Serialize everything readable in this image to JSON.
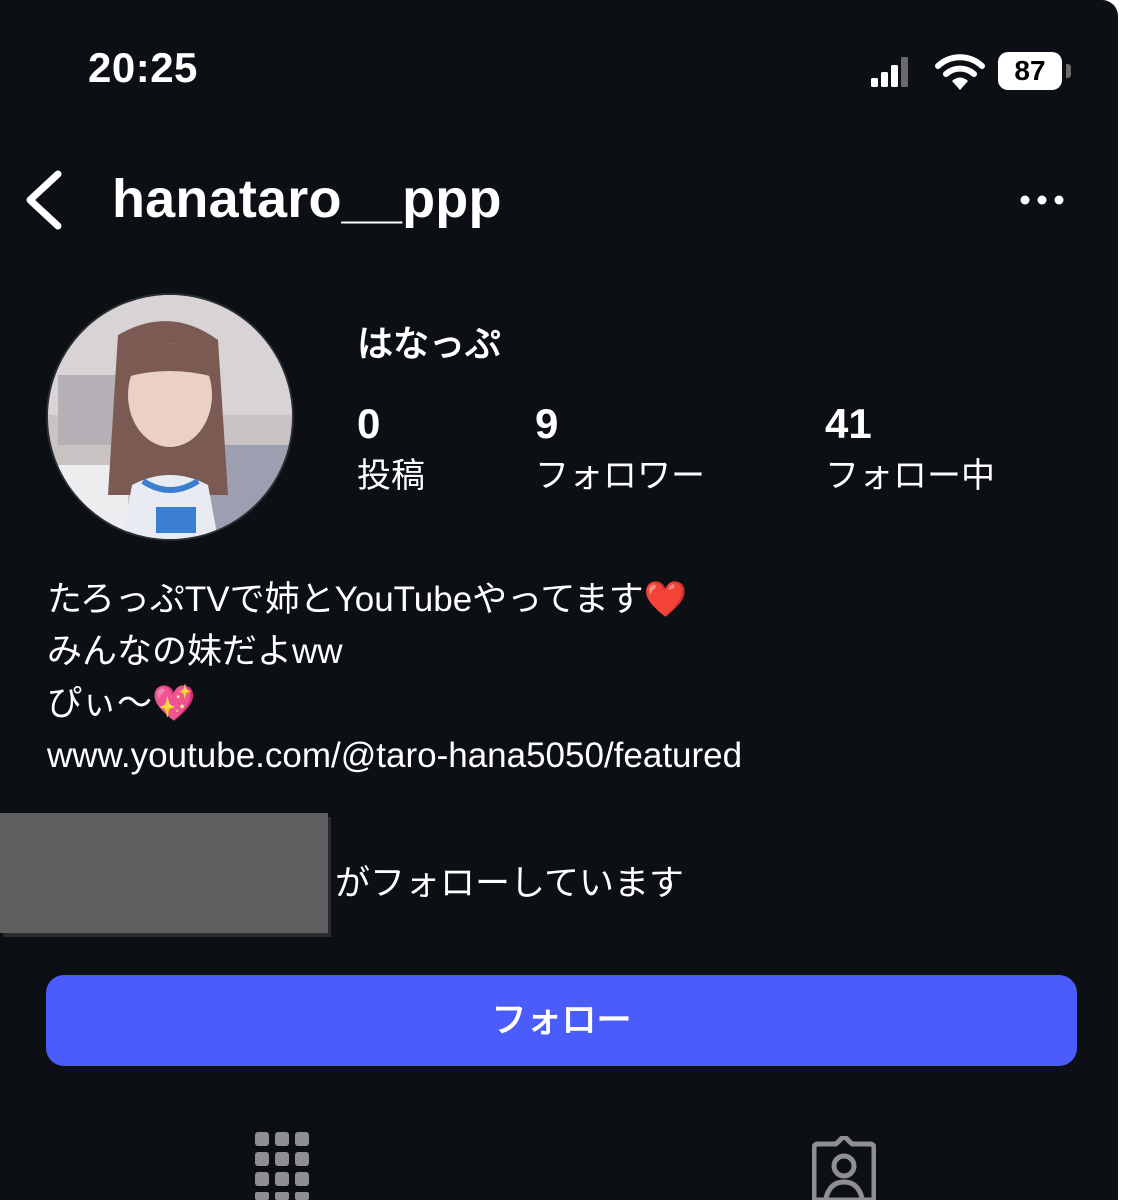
{
  "status_bar": {
    "time": "20:25",
    "battery": "87",
    "icons": [
      "signal-icon",
      "wifi-icon",
      "battery-icon"
    ]
  },
  "header": {
    "username": "hanataro__ppp",
    "icons": [
      "chevron-left-icon",
      "more-dots-icon"
    ]
  },
  "profile": {
    "display_name": "はなっぷ",
    "stats": {
      "posts": {
        "count": "0",
        "label": "投稿"
      },
      "followers": {
        "count": "9",
        "label": "フォロワー"
      },
      "following": {
        "count": "41",
        "label": "フォロー中"
      }
    }
  },
  "bio": {
    "line1": "たろっぷTVで姉とYouTubeやってます",
    "line1_emoji": "❤️",
    "line2": "みんなの妹だよww",
    "line3": "ぴぃ〜",
    "line3_emoji": "💖",
    "link": "www.youtube.com/@taro-hana5050/featured"
  },
  "followed_by": {
    "suffix": "がフォローしています"
  },
  "actions": {
    "follow_label": "フォロー"
  },
  "tabs": [
    "grid-icon",
    "tagged-person-icon"
  ],
  "colors": {
    "background": "#0c0f14",
    "follow_button": "#4a5dfa",
    "text": "#ffffff"
  }
}
